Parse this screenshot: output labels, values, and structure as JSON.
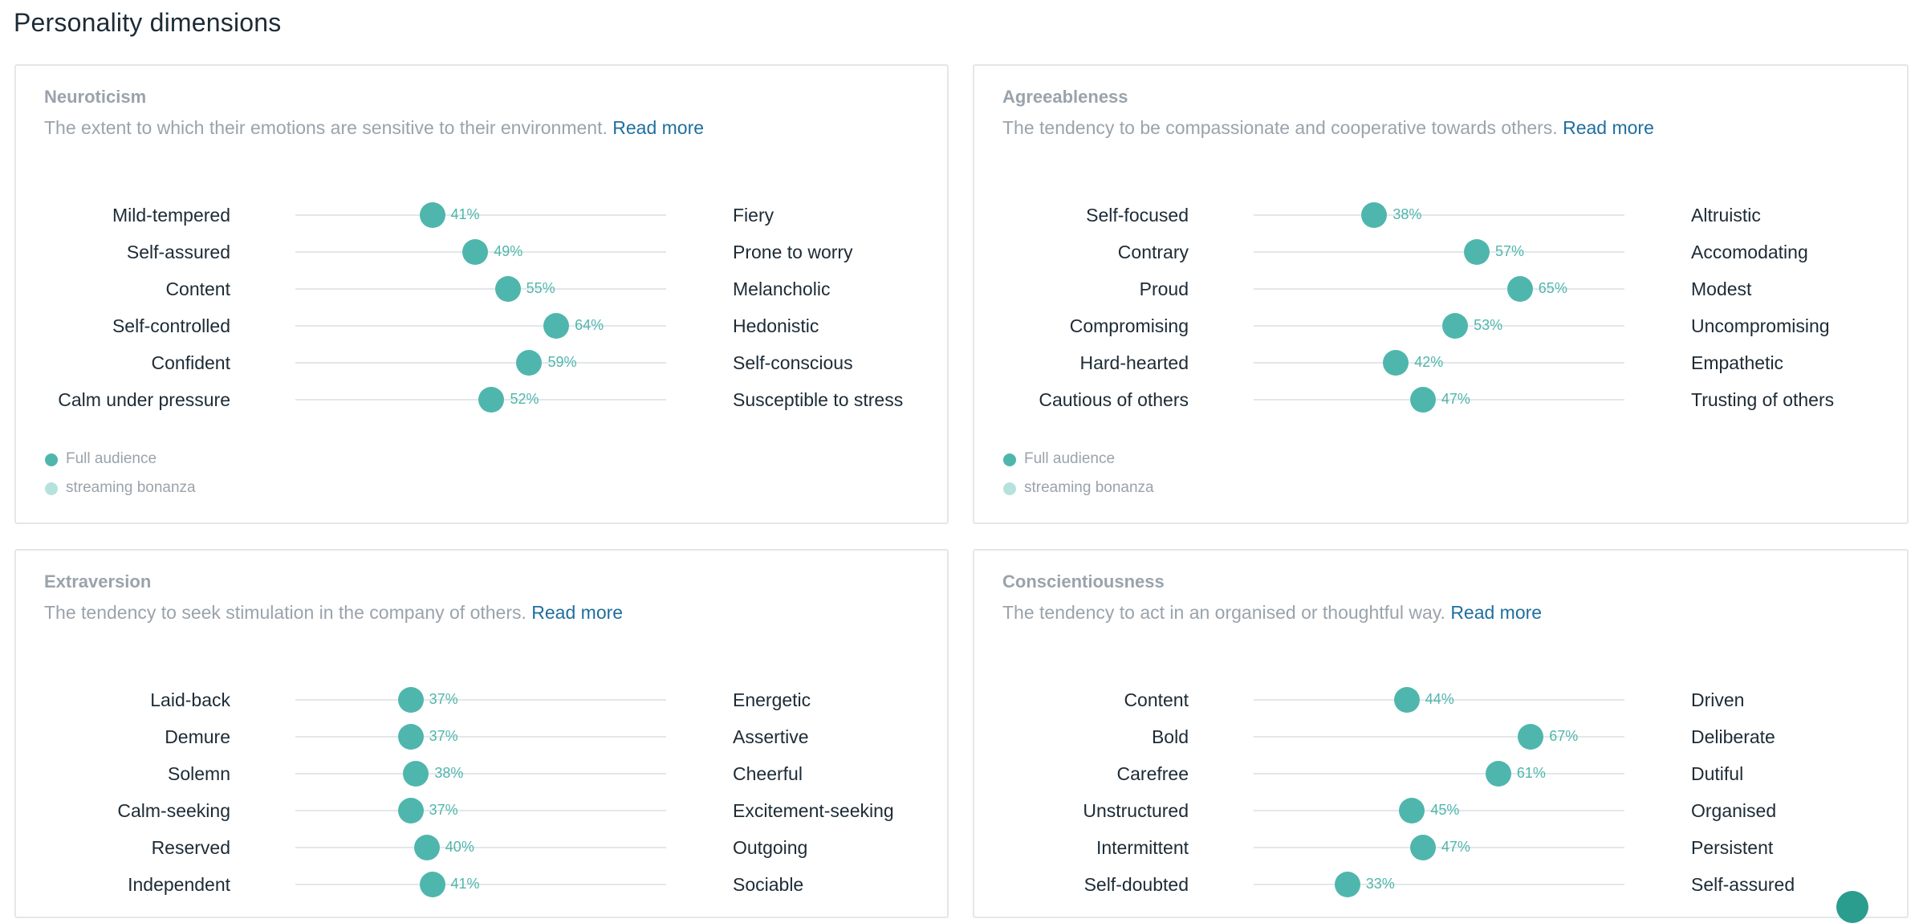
{
  "page": {
    "title": "Personality dimensions"
  },
  "colors": {
    "accent": "#4fb6ad",
    "accent_light": "#b6e2dd",
    "link": "#1f6f9f",
    "muted_text": "#9aa3ab",
    "text": "#1d2b36",
    "border": "#e3e7ea"
  },
  "cards": [
    {
      "title": "Neuroticism",
      "description": "The extent to which their emotions are sensitive to their environment.",
      "read_more": "Read more",
      "rows": [
        {
          "left": "Mild-tempered",
          "right": "Fiery",
          "value": 41,
          "label": "41%"
        },
        {
          "left": "Self-assured",
          "right": "Prone to worry",
          "value": 49,
          "label": "49%"
        },
        {
          "left": "Content",
          "right": "Melancholic",
          "value": 55,
          "label": "55%"
        },
        {
          "left": "Self-controlled",
          "right": "Hedonistic",
          "value": 64,
          "label": "64%"
        },
        {
          "left": "Confident",
          "right": "Self-conscious",
          "value": 59,
          "label": "59%"
        },
        {
          "left": "Calm under pressure",
          "right": "Susceptible to stress",
          "value": 52,
          "label": "52%"
        }
      ],
      "legend": [
        "Full audience",
        "streaming bonanza"
      ]
    },
    {
      "title": "Agreeableness",
      "description": "The tendency to be compassionate and cooperative towards others.",
      "read_more": "Read more",
      "rows": [
        {
          "left": "Self-focused",
          "right": "Altruistic",
          "value": 38,
          "label": "38%"
        },
        {
          "left": "Contrary",
          "right": "Accomodating",
          "value": 57,
          "label": "57%"
        },
        {
          "left": "Proud",
          "right": "Modest",
          "value": 65,
          "label": "65%"
        },
        {
          "left": "Compromising",
          "right": "Uncompromising",
          "value": 53,
          "label": "53%"
        },
        {
          "left": "Hard-hearted",
          "right": "Empathetic",
          "value": 42,
          "label": "42%"
        },
        {
          "left": "Cautious of others",
          "right": "Trusting of others",
          "value": 47,
          "label": "47%"
        }
      ],
      "legend": [
        "Full audience",
        "streaming bonanza"
      ]
    },
    {
      "title": "Extraversion",
      "description": "The tendency to seek stimulation in the company of others.",
      "read_more": "Read more",
      "rows": [
        {
          "left": "Laid-back",
          "right": "Energetic",
          "value": 37,
          "label": "37%"
        },
        {
          "left": "Demure",
          "right": "Assertive",
          "value": 37,
          "label": "37%"
        },
        {
          "left": "Solemn",
          "right": "Cheerful",
          "value": 38,
          "label": "38%"
        },
        {
          "left": "Calm-seeking",
          "right": "Excitement-seeking",
          "value": 37,
          "label": "37%"
        },
        {
          "left": "Reserved",
          "right": "Outgoing",
          "value": 40,
          "label": "40%"
        },
        {
          "left": "Independent",
          "right": "Sociable",
          "value": 41,
          "label": "41%"
        }
      ],
      "legend": []
    },
    {
      "title": "Conscientiousness",
      "description": "The tendency to act in an organised or thoughtful way.",
      "read_more": "Read more",
      "rows": [
        {
          "left": "Content",
          "right": "Driven",
          "value": 44,
          "label": "44%"
        },
        {
          "left": "Bold",
          "right": "Deliberate",
          "value": 67,
          "label": "67%"
        },
        {
          "left": "Carefree",
          "right": "Dutiful",
          "value": 61,
          "label": "61%"
        },
        {
          "left": "Unstructured",
          "right": "Organised",
          "value": 45,
          "label": "45%"
        },
        {
          "left": "Intermittent",
          "right": "Persistent",
          "value": 47,
          "label": "47%"
        },
        {
          "left": "Self-doubted",
          "right": "Self-assured",
          "value": 33,
          "label": "33%"
        }
      ],
      "legend": []
    }
  ]
}
